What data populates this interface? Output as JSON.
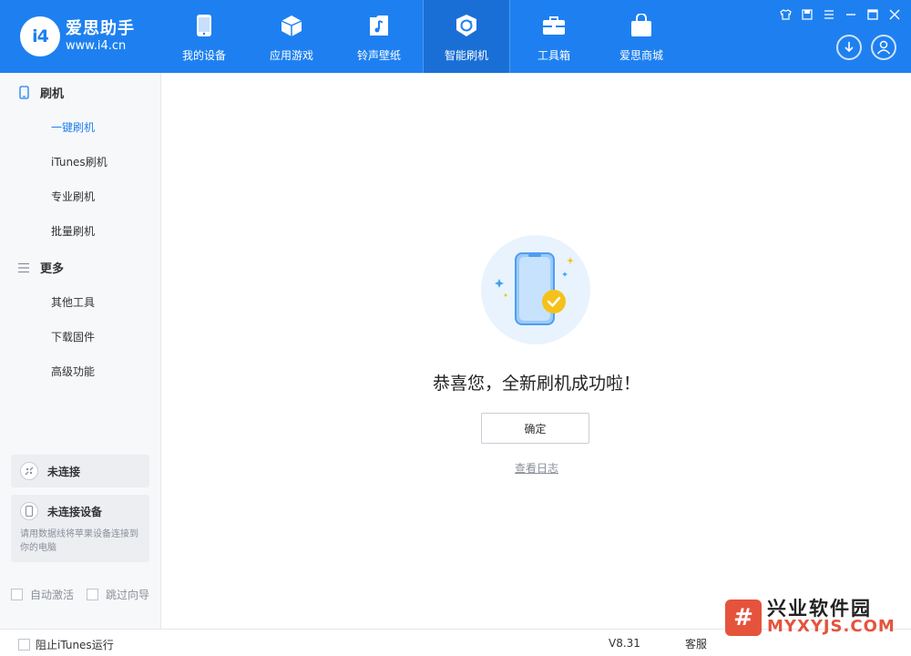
{
  "app": {
    "logo_badge": "i4",
    "logo_name": "爱思助手",
    "logo_url": "www.i4.cn"
  },
  "nav": [
    {
      "label": "我的设备",
      "icon": "phone-icon"
    },
    {
      "label": "应用游戏",
      "icon": "cube-icon"
    },
    {
      "label": "铃声壁纸",
      "icon": "music-file-icon"
    },
    {
      "label": "智能刷机",
      "icon": "refresh-shield-icon",
      "active": true
    },
    {
      "label": "工具箱",
      "icon": "toolbox-icon"
    },
    {
      "label": "爱思商城",
      "icon": "shopping-bag-icon"
    }
  ],
  "window_controls": [
    "shirt-icon",
    "note-icon",
    "menu-icon",
    "minimize-icon",
    "maximize-icon",
    "close-icon"
  ],
  "header_buttons": [
    "download-icon",
    "user-icon"
  ],
  "sidebar": {
    "section_flash": "刷机",
    "flash_items": [
      "一键刷机",
      "iTunes刷机",
      "专业刷机",
      "批量刷机"
    ],
    "section_more": "更多",
    "more_items": [
      "其他工具",
      "下载固件",
      "高级功能"
    ],
    "status_disconnected": "未连接",
    "status_no_device": "未连接设备",
    "status_no_device_desc": "请用数据线将苹果设备连接到你的电脑",
    "auto_activate": "自动激活",
    "skip_guide": "跳过向导"
  },
  "main": {
    "success_message": "恭喜您，全新刷机成功啦！",
    "ok_button": "确定",
    "view_log": "查看日志"
  },
  "footer": {
    "block_itunes": "阻止iTunes运行",
    "version": "V8.31",
    "service": "客服"
  },
  "watermark": {
    "cn": "兴业软件园",
    "en": "MYXYJS.COM"
  },
  "colors": {
    "primary": "#1e80f0",
    "success": "#f5c21b"
  }
}
